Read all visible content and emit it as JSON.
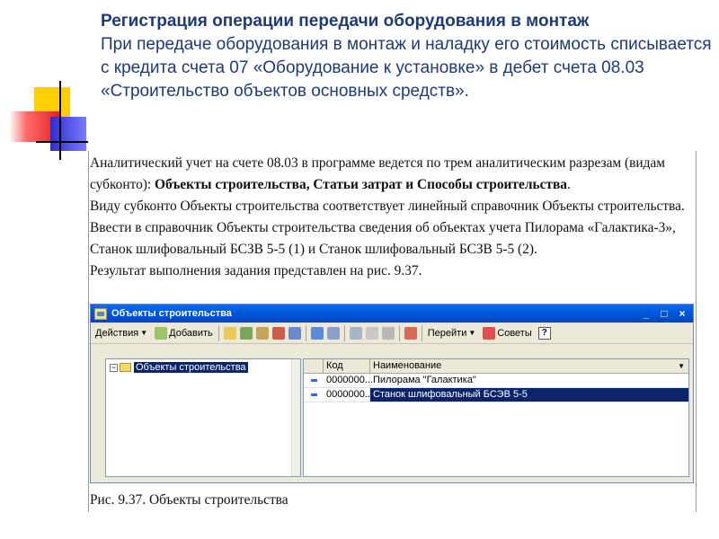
{
  "slide": {
    "title": "Регистрация операции передачи оборудования в монтаж",
    "intro": "При передаче оборудования в монтаж и наладку его стоимость списывается с кредита счета 07 «Оборудование к установке» в дебет счета 08.03 «Строительство объектов основных средств»."
  },
  "doc": {
    "p1_a": "Аналитический учет на счете 08.03 в программе ведется по трем аналитическим разрезам (видам субконто): ",
    "p1_bold": "Объекты строительства, Статьи затрат и Способы строительства",
    "p1_b": ".",
    "p2": "Виду субконто Объекты строительства соответствует линейный справочник Объекты строительства.",
    "p3": "Ввести в справочник Объекты строительства сведения об объектах учета Пилорама «Галактика-3», Станок шлифовальный БСЗВ 5-5 (1) и Станок шлифовальный БСЗВ 5-5 (2).",
    "p4": "Результат выполнения задания представлен на рис. 9.37.",
    "caption": "Рис. 9.37. Объекты строительства"
  },
  "window": {
    "title": "Объекты строительства",
    "controls": {
      "minimize": "_",
      "maximize": "□",
      "close": "×"
    },
    "toolbar": {
      "actions": "Действия",
      "add": "Добавить",
      "goto": "Перейти",
      "tips": "Советы",
      "help": "?"
    },
    "tree": {
      "expand": "−",
      "root": "Объекты строительства"
    },
    "list": {
      "headers": {
        "code": "Код",
        "name": "Наименование"
      },
      "rows": [
        {
          "code": "0000000...",
          "name": "Пилорама \"Галактика\"",
          "selected": false
        },
        {
          "code": "0000000...",
          "name": "Станок шлифовальный БСЭВ 5-5",
          "selected": true
        }
      ]
    }
  },
  "colors": {
    "title_text": "#1f3a7a",
    "titlebar": "#0056d8",
    "selection": "#0a246a"
  }
}
